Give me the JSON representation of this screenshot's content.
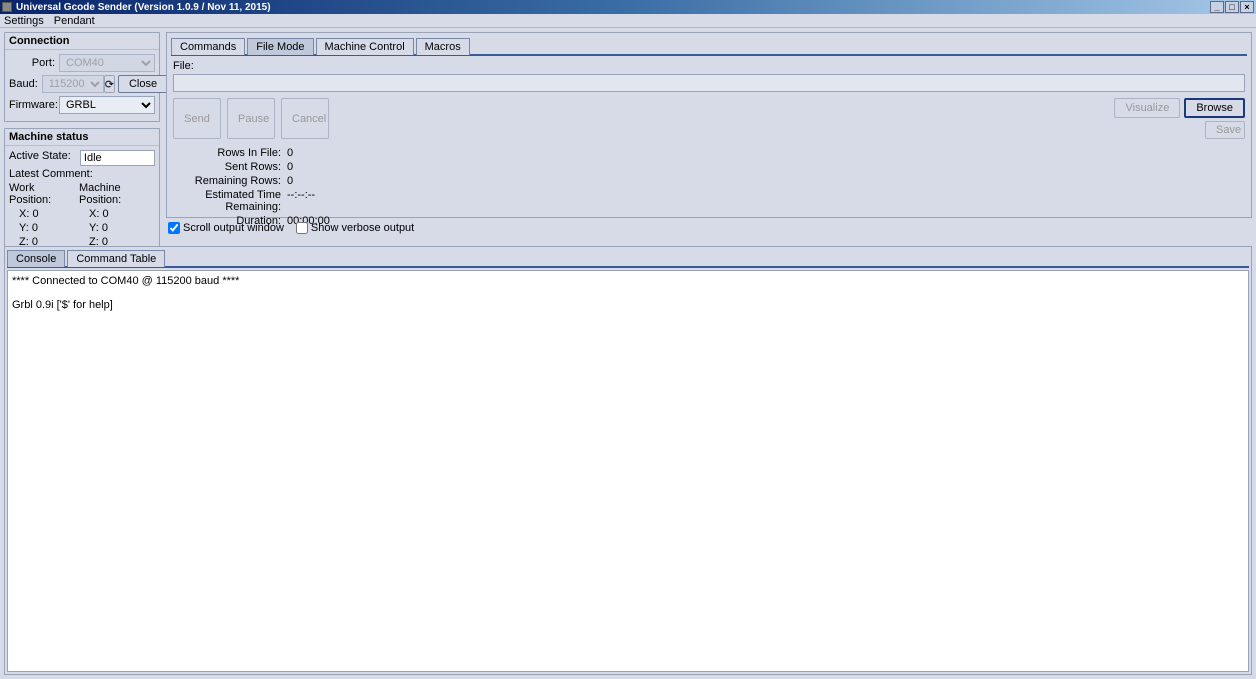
{
  "title_bar": {
    "title": "Universal Gcode Sender (Version 1.0.9 / Nov 11, 2015)"
  },
  "menu": {
    "settings": "Settings",
    "pendant": "Pendant"
  },
  "connection": {
    "title": "Connection",
    "port_label": "Port:",
    "port_value": "COM40",
    "baud_label": "Baud:",
    "baud_value": "115200",
    "close_btn": "Close",
    "firmware_label": "Firmware:",
    "firmware_value": "GRBL"
  },
  "machine_status": {
    "title": "Machine status",
    "active_state_label": "Active State:",
    "active_state_value": "Idle",
    "latest_comment_label": "Latest Comment:",
    "work_position_label": "Work Position:",
    "machine_position_label": "Machine Position:",
    "x_label": "X:",
    "y_label": "Y:",
    "z_label": "Z:",
    "work_x": "0",
    "work_y": "0",
    "work_z": "0",
    "mach_x": "0",
    "mach_y": "0",
    "mach_z": "0"
  },
  "tabs": {
    "commands": "Commands",
    "file_mode": "File Mode",
    "machine_control": "Machine Control",
    "macros": "Macros"
  },
  "file_panel": {
    "file_label": "File:",
    "send": "Send",
    "pause": "Pause",
    "cancel": "Cancel",
    "visualize": "Visualize",
    "browse": "Browse",
    "save": "Save",
    "rows_in_file_label": "Rows In File:",
    "rows_in_file_value": "0",
    "sent_rows_label": "Sent Rows:",
    "sent_rows_value": "0",
    "remaining_rows_label": "Remaining Rows:",
    "remaining_rows_value": "0",
    "est_time_label": "Estimated Time Remaining:",
    "est_time_value": "--:--:--",
    "duration_label": "Duration:",
    "duration_value": "00:00:00"
  },
  "checks": {
    "scroll_output": "Scroll output window",
    "show_verbose": "Show verbose output"
  },
  "console_tabs": {
    "console": "Console",
    "command_table": "Command Table"
  },
  "console_output": "**** Connected to COM40 @ 115200 baud ****\n\nGrbl 0.9i ['$' for help]"
}
